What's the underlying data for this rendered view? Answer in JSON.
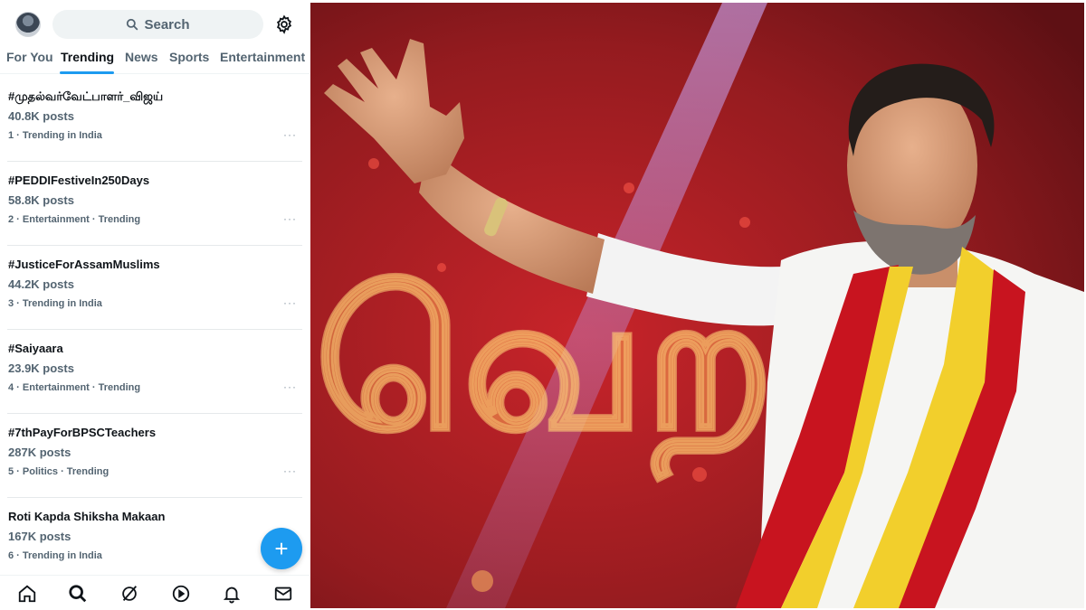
{
  "search": {
    "label": "Search"
  },
  "tabs": [
    "For You",
    "Trending",
    "News",
    "Sports",
    "Entertainment"
  ],
  "active_tab": "Trending",
  "trends": [
    {
      "name": "#முதல்வர்வேட்பாளர்_விஜய்",
      "posts": "40.8K posts",
      "meta": "1 · Trending in India"
    },
    {
      "name": "#PEDDIFestiveIn250Days",
      "posts": "58.8K posts",
      "meta": "2 · Entertainment · Trending"
    },
    {
      "name": "#JusticeForAssamMuslims",
      "posts": "44.2K posts",
      "meta": "3 · Trending in India"
    },
    {
      "name": "#Saiyaara",
      "posts": "23.9K posts",
      "meta": "4 · Entertainment · Trending"
    },
    {
      "name": "#7thPayForBPSCTeachers",
      "posts": "287K posts",
      "meta": "5 · Politics · Trending"
    },
    {
      "name": "Roti Kapda Shiksha Makaan",
      "posts": "167K posts",
      "meta": "6 · Trending in India"
    }
  ],
  "more_label": "···",
  "fab": {
    "label": "+"
  },
  "bottom_nav": [
    "home-icon",
    "search-icon",
    "grok-icon",
    "video-icon",
    "notifications-icon",
    "messages-icon"
  ],
  "colors": {
    "accent": "#1d9bf0",
    "text": "#0f1419",
    "secondary": "#536471",
    "backdrop_red": "#8d1a1e"
  },
  "photo": {
    "backdrop_text": "வெற்றி"
  }
}
